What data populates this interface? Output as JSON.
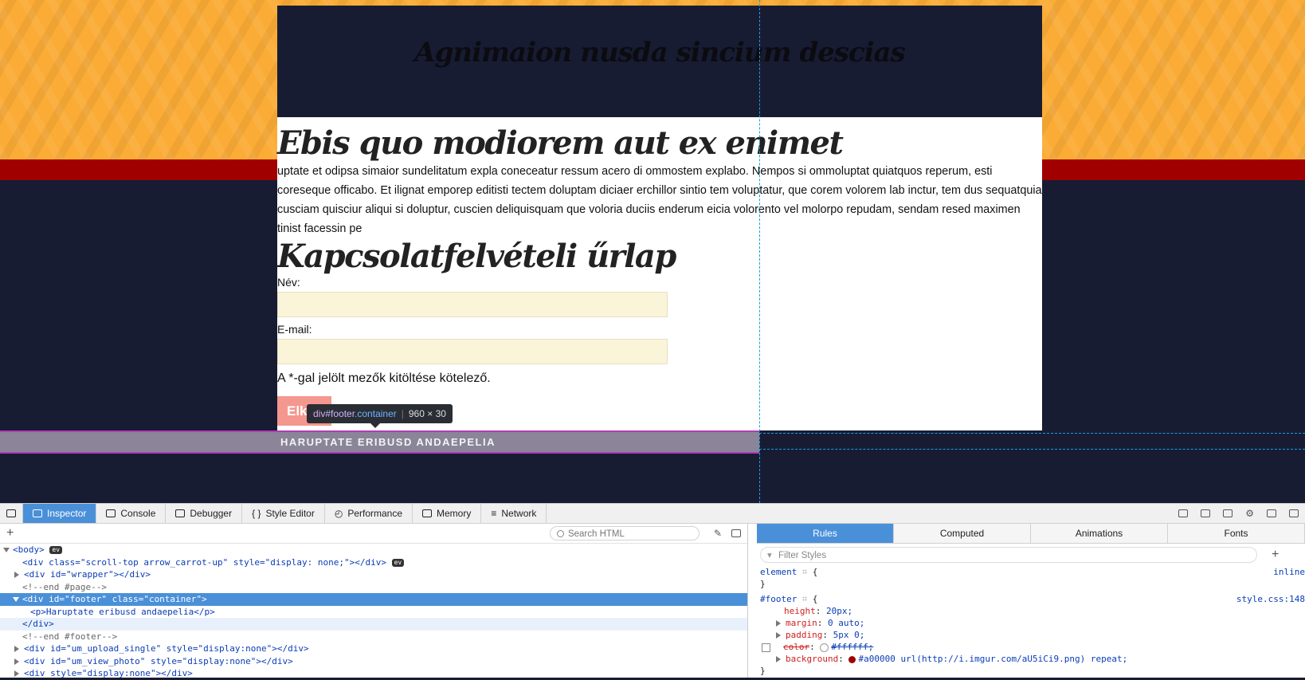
{
  "page": {
    "header_title": "Agnimaion nusda sincium descias",
    "heading": "Ebis quo modiorem aut ex enimet",
    "paragraph": "uptate et odipsa simaior sundelitatum expla coneceatur ressum acero di ommostem explabo. Nempos si ommoluptat quiatquos reperum, esti coreseque officabo. Et ilignat emporep editisti tectem doluptam diciaer erchillor sintio tem voluptatur, que corem volorem lab inctur, tem dus sequatquia cusciam quisciur aliqui si doluptur, cuscien deliquisquam que voloria duciis enderum eicia volorento vel molorpo repudam, sendam resed maximen tinist facessin pe",
    "form_heading": "Kapcsolatfelvételi űrlap",
    "name_label": "Név:",
    "email_label": "E-mail:",
    "required_note": "A *-gal jelölt mezők kitöltése kötelező.",
    "submit_label": "Elk",
    "footer_text": "HARUPTATE ERIBUSD ANDAEPELIA"
  },
  "tooltip": {
    "tag": "div",
    "id": "#footer",
    "class": ".container",
    "size": "960 × 30"
  },
  "colors": {
    "accent_orange": "#fbac36",
    "accent_red": "#a00000",
    "navy": "#171c33",
    "devtools_blue": "#4a90d9"
  },
  "devtools": {
    "tabs": [
      "Inspector",
      "Console",
      "Debugger",
      "Style Editor",
      "Performance",
      "Memory",
      "Network"
    ],
    "active_tab": "Inspector",
    "search_placeholder": "Search HTML",
    "html_lines": {
      "body": "<body>",
      "scroll_top": "<div class=\"scroll-top arrow_carrot-up\" style=\"display: none;\"></div>",
      "wrapper": "<div id=\"wrapper\"></div>",
      "end_page": "<!--end #page-->",
      "footer_open": "<div id=\"footer\" class=\"container\">",
      "footer_p": "<p>Haruptate eribusd andaepelia</p>",
      "footer_close": "</div>",
      "end_footer": "<!--end #footer-->",
      "upload": "<div id=\"um_upload_single\" style=\"display:none\"></div>",
      "view_photo": "<div id=\"um_view_photo\" style=\"display:none\"></div>",
      "last": "<div style=\"display:none\"></div>"
    },
    "right_tabs": [
      "Rules",
      "Computed",
      "Animations",
      "Fonts"
    ],
    "filter_placeholder": "Filter Styles",
    "rules": {
      "element_selector": "element",
      "element_source": "inline",
      "footer_selector": "#footer",
      "footer_source": "style.css:148",
      "props": [
        {
          "name": "height",
          "value": "20px;"
        },
        {
          "name": "margin",
          "value": "0 auto;"
        },
        {
          "name": "padding",
          "value": "5px 0;"
        },
        {
          "name": "color",
          "value": "#ffffff;"
        },
        {
          "name": "background",
          "value": "#a00000 url(http://i.imgur.com/aU5iCi9.png) repeat;"
        }
      ]
    }
  }
}
